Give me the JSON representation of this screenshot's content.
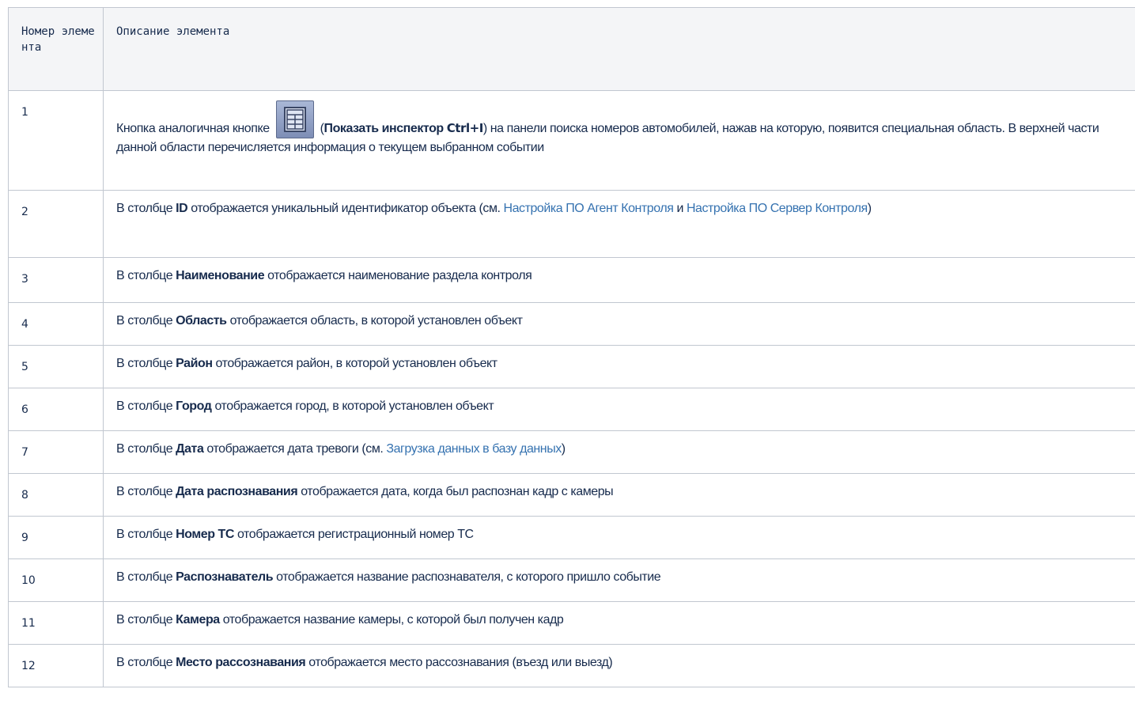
{
  "header": {
    "col1": "Номер элемента",
    "col2": "Описание элемента"
  },
  "rows": [
    {
      "num": "1",
      "p1": "Кнопка аналогичная кнопке",
      "p2": "(",
      "b1": "Показать инспектор",
      "b2": "Ctrl+I",
      "p3": ") на панели поиска номеров автомобилей, нажав на которую, появится специальная область. В верхней части данной области перечисляется информация о текущем выбранном событии",
      "icon": "inspector-table-icon"
    },
    {
      "num": "2",
      "p1": "В столбце ",
      "b1": "ID",
      "p2": " отображается уникальный идентификатор объекта (см. ",
      "l1": "Настройка ПО Агент Контроля",
      "p3": " и ",
      "l2": "Настройка ПО Сервер Контроля",
      "p4": ")"
    },
    {
      "num": "3",
      "p1": "В столбце ",
      "b1": "Наименование",
      "p2": " отображается наименование раздела контроля"
    },
    {
      "num": "4",
      "p1": "В столбце ",
      "b1": "Область",
      "p2": " отображается область, в которой установлен объект"
    },
    {
      "num": "5",
      "p1": "В столбце ",
      "b1": "Район",
      "p2": " отображается район, в которой установлен объект"
    },
    {
      "num": "6",
      "p1": "В столбце ",
      "b1": "Город",
      "p2": " отображается город, в которой установлен объект"
    },
    {
      "num": "7",
      "p1": "В столбце ",
      "b1": "Дата",
      "p2": " отображается дата тревоги (см. ",
      "l1": "Загрузка данных в базу данных",
      "p3": ")"
    },
    {
      "num": "8",
      "p1": "В столбце ",
      "b1": "Дата распознавания",
      "p2": " отображается дата, когда был распознан кадр с камеры"
    },
    {
      "num": "9",
      "p1": "В столбце ",
      "b1": "Номер ТС",
      "p2": " отображается регистрационный номер ТС"
    },
    {
      "num": "10",
      "p1": "В столбце ",
      "b1": "Распознаватель",
      "p2": " отображается название распознавателя, с которого пришло событие"
    },
    {
      "num": "11",
      "p1": "В столбце ",
      "b1": "Камера",
      "p2": " отображается название камеры, с которой был получен кадр"
    },
    {
      "num": "12",
      "p1": "В столбце ",
      "b1": "Место рассознавания",
      "p2": " отображается место рассознавания (въезд или выезд)"
    }
  ],
  "colors": {
    "text": "#172b4d",
    "link": "#3572b0",
    "border": "#c1c7d0",
    "header_bg": "#f4f5f7"
  }
}
